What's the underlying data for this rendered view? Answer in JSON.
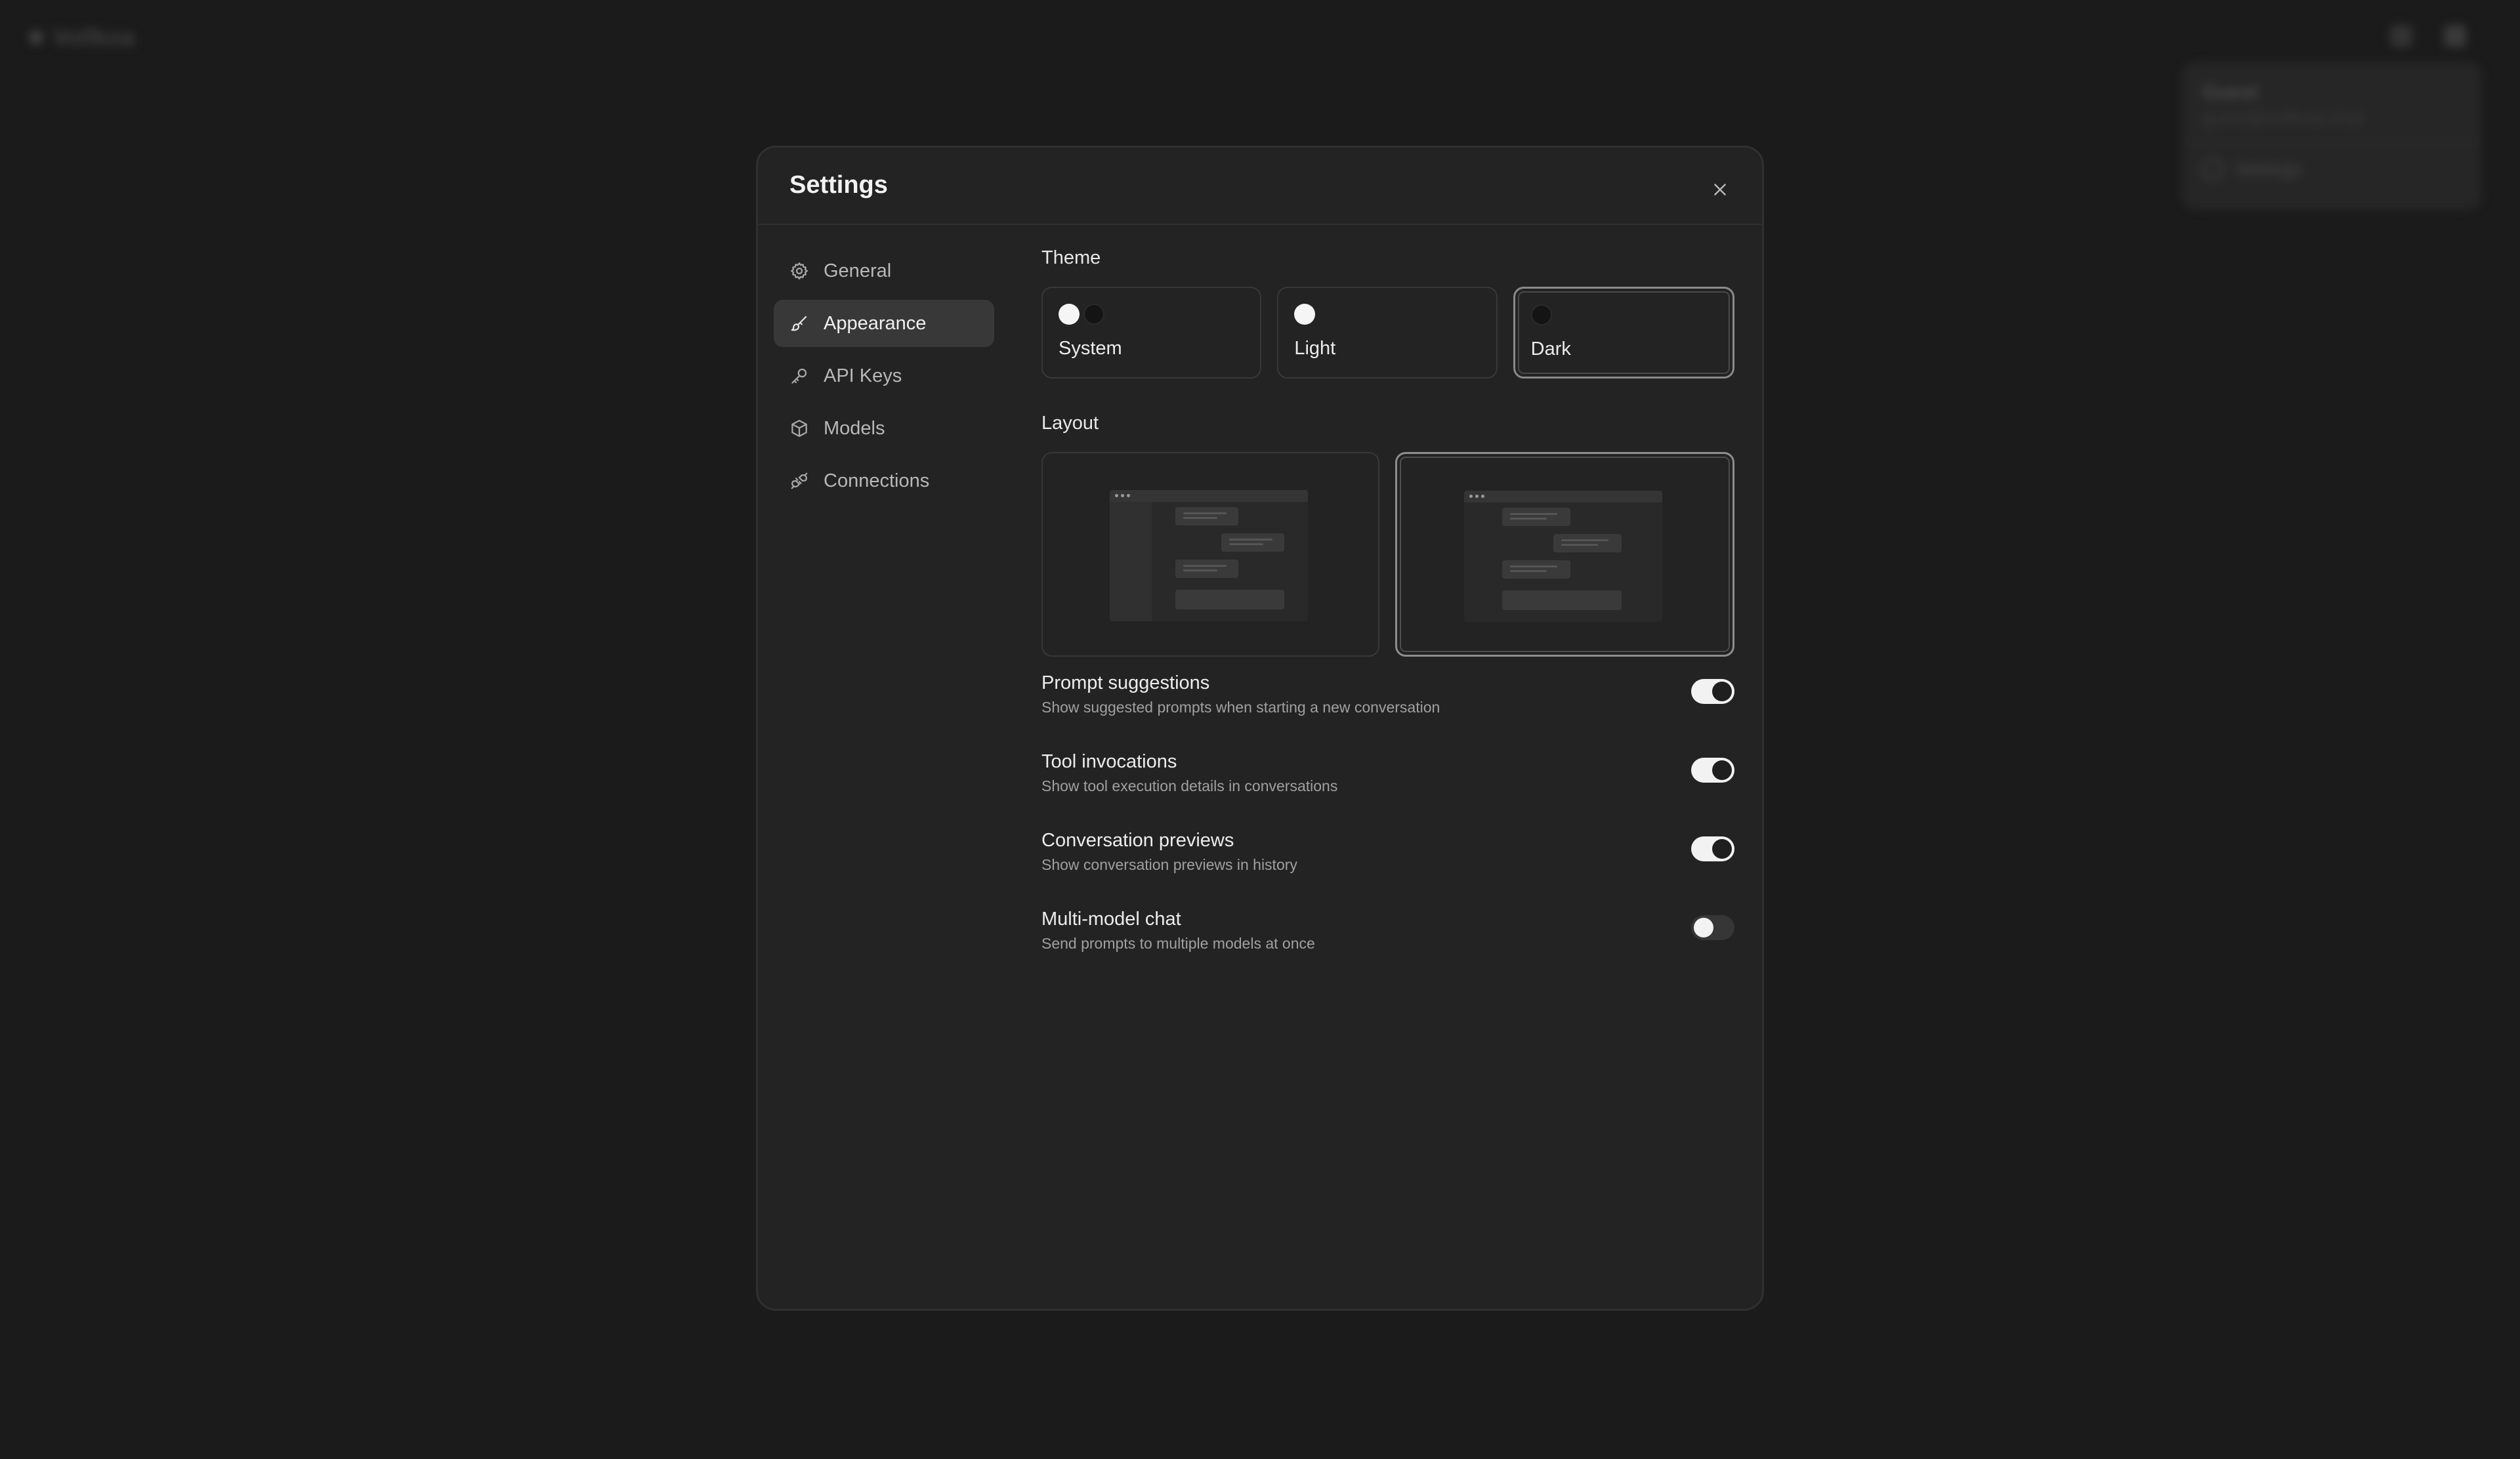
{
  "background": {
    "brand": "Vollkoa",
    "menu": {
      "name": "Guest",
      "email": "guest@vollkoa.chat",
      "item": "Settings"
    }
  },
  "modal": {
    "title": "Settings",
    "nav": [
      {
        "label": "General",
        "icon": "gear-icon"
      },
      {
        "label": "Appearance",
        "icon": "brush-icon",
        "active": true
      },
      {
        "label": "API Keys",
        "icon": "key-icon"
      },
      {
        "label": "Models",
        "icon": "cube-icon"
      },
      {
        "label": "Connections",
        "icon": "plug-icon"
      }
    ],
    "appearance": {
      "theme_label": "Theme",
      "themes": [
        {
          "label": "System",
          "selected": false
        },
        {
          "label": "Light",
          "selected": false
        },
        {
          "label": "Dark",
          "selected": true
        }
      ],
      "layout_label": "Layout",
      "layouts": [
        {
          "name": "sidebar",
          "selected": false
        },
        {
          "name": "fullscreen",
          "selected": true
        }
      ],
      "toggles": [
        {
          "title": "Prompt suggestions",
          "desc": "Show suggested prompts when starting a new conversation",
          "on": true
        },
        {
          "title": "Tool invocations",
          "desc": "Show tool execution details in conversations",
          "on": true
        },
        {
          "title": "Conversation previews",
          "desc": "Show conversation previews in history",
          "on": true
        },
        {
          "title": "Multi-model chat",
          "desc": "Send prompts to multiple models at once",
          "on": false
        }
      ]
    }
  },
  "colors": {
    "background": "#1b1b1b",
    "modal": "#232323",
    "active_nav": "#383838",
    "switch_on": "#f2f2f2",
    "switch_off": "#363636"
  }
}
